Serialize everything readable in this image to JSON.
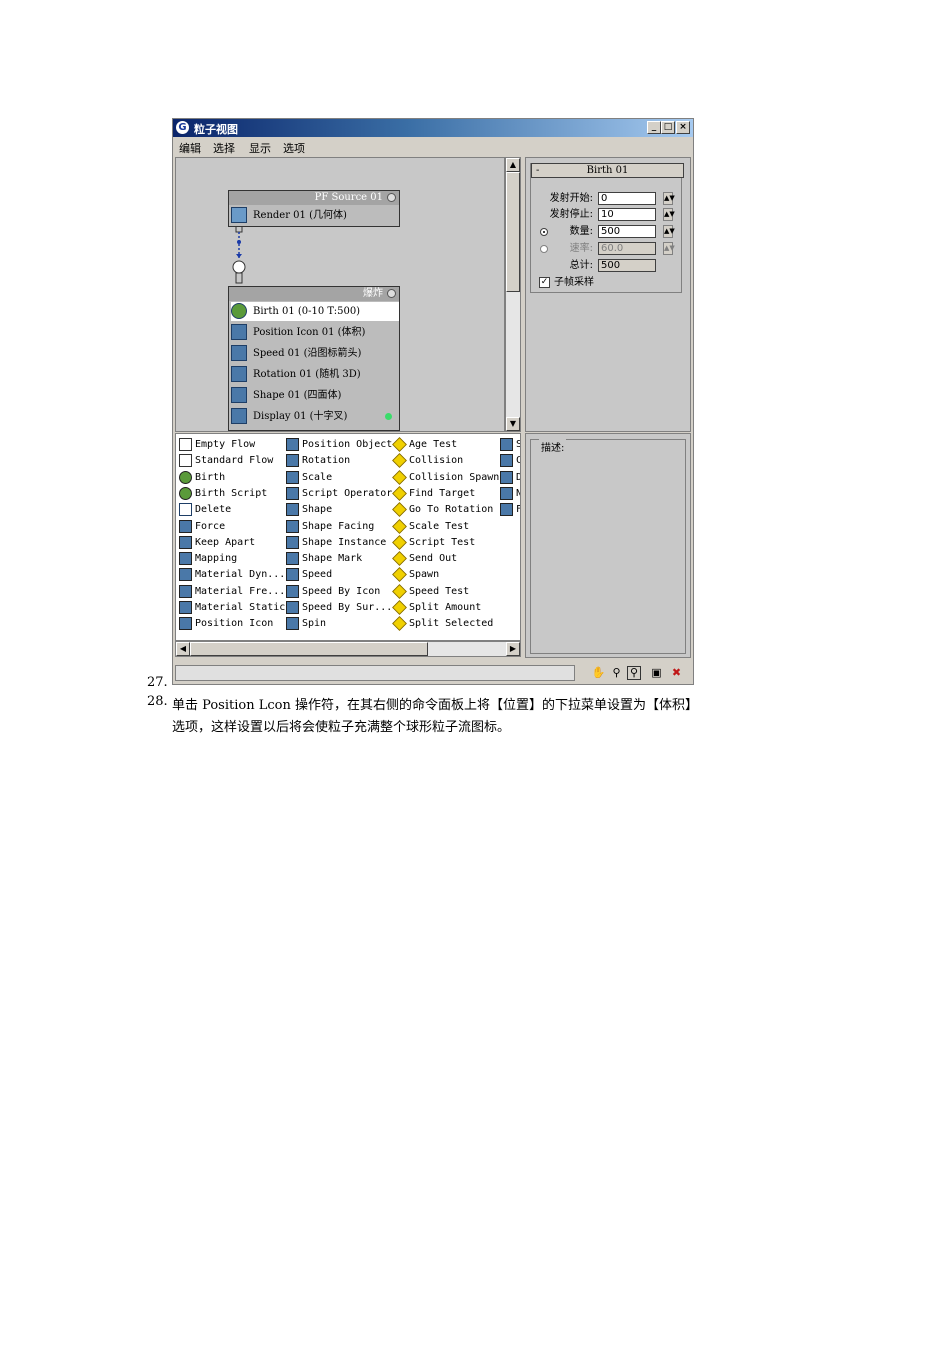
{
  "window": {
    "title": "粒子视图",
    "menu": [
      "编辑",
      "选择",
      "显示",
      "选项"
    ]
  },
  "nodes": {
    "source": {
      "title": "PF Source 01",
      "ops": [
        "Render 01 (几何体)"
      ]
    },
    "event": {
      "title": "爆炸",
      "ops": [
        "Birth 01 (0-10 T:500)",
        "Position Icon 01 (体积)",
        "Speed 01 (沿图标箭头)",
        "Rotation 01 (随机 3D)",
        "Shape 01 (四面体)",
        "Display 01 (十字叉)"
      ]
    }
  },
  "rollout": {
    "title": "Birth 01",
    "collapse": "-",
    "emit_start_label": "发射开始:",
    "emit_start": "0",
    "emit_stop_label": "发射停止:",
    "emit_stop": "10",
    "amount_label": "数量:",
    "amount": "500",
    "rate_label": "速率:",
    "rate": "60.0",
    "total_label": "总计:",
    "total": "500",
    "subframe_label": "子帧采样"
  },
  "depot": {
    "col1": [
      "Empty Flow",
      "Standard Flow",
      "Birth",
      "Birth Script",
      "Delete",
      "Force",
      "Keep Apart",
      "Mapping",
      "Material Dyn...",
      "Material Fre...",
      "Material Static",
      "Position Icon"
    ],
    "col2": [
      "Position Object",
      "Rotation",
      "Scale",
      "Script Operator",
      "Shape",
      "Shape Facing",
      "Shape Instance",
      "Shape Mark",
      "Speed",
      "Speed By Icon",
      "Speed By Sur...",
      "Spin"
    ],
    "col3": [
      "Age Test",
      "Collision",
      "Collision Spawn",
      "Find Target",
      "Go To Rotation",
      "Scale Test",
      "Script Test",
      "Send Out",
      "Spawn",
      "Speed Test",
      "Split Amount",
      "Split Selected"
    ],
    "col4": [
      "S",
      "C",
      "D",
      "N",
      "F"
    ]
  },
  "description_label": "描述:",
  "caption": {
    "num27": "27.",
    "num28": "28.",
    "line1": "单击 Position Lcon 操作符，在其右侧的命令面板上将【位置】的下拉菜单设置为【体积】",
    "line2": "选项，这样设置以后将会使粒子充满整个球形粒子流图标。"
  }
}
